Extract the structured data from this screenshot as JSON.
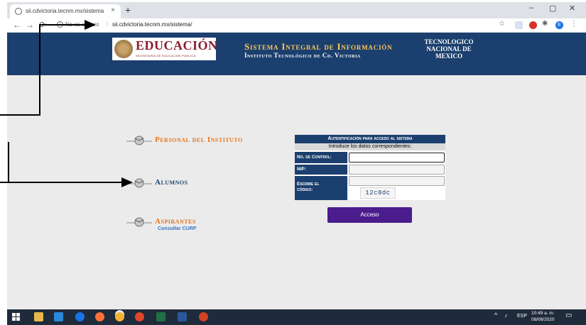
{
  "browser": {
    "tab_title": "sii.cdvictoria.tecnm.mx/sistema",
    "tab_close": "×",
    "new_tab": "+",
    "window_controls": [
      "–",
      "▢",
      "✕"
    ],
    "security_label": "No es seguro",
    "url": "sii.cdvictoria.tecnm.mx/sistema/",
    "extension_badge": "E"
  },
  "header": {
    "logo_word": "EDUCACIÓN",
    "logo_sub": "SECRETARÍA DE EDUCACIÓN PÚBLICA",
    "title": "Sistema Integral de Información",
    "subtitle": "Instituto Tecnológico de Cd. Victoria",
    "org_line1": "TECNOLOGICO",
    "org_line2": "NACIONAL DE",
    "org_line3": "MEXICO",
    "colors": {
      "band": "#1b3f6e",
      "title": "#ffc857"
    }
  },
  "menu": {
    "personal": "Personal del Instituto",
    "alumnos": "Alumnos",
    "aspirantes": "Aspirantes",
    "curp": "Consultar CURP"
  },
  "login": {
    "heading": "Autentificación para acceso al sistema",
    "intro": "Introduce los datos correspondientes:",
    "control_label": "No. de Control:",
    "nip_label": "NIP:",
    "code_label_1": "Escribe el",
    "code_label_2": "código:",
    "captcha": "12c8dc",
    "submit": "Acceso"
  },
  "taskbar": {
    "tray_lang": "ESP",
    "time": "10:49 a. m.",
    "date": "08/08/2020"
  }
}
